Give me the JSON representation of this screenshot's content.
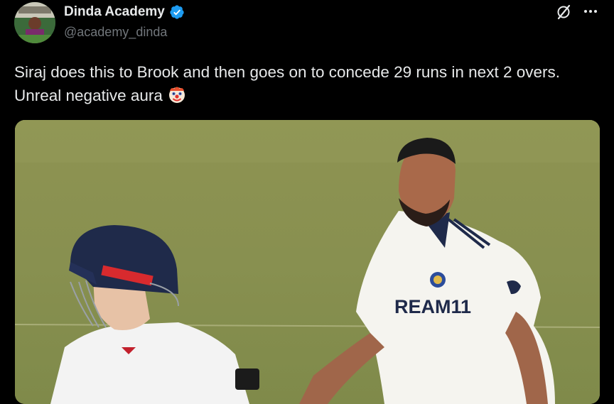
{
  "author": {
    "display_name": "Dinda Academy",
    "handle": "@academy_dinda",
    "verified": true
  },
  "icons": {
    "verified": "verified-badge-icon",
    "grok": "grok-icon",
    "more": "more-options-icon",
    "clown": "clown-face-icon"
  },
  "tweet": {
    "text": "Siraj does this to Brook and then goes on to concede 29 runs in next 2 overs. Unreal negative aura",
    "emoji": "clown-face"
  },
  "media": {
    "kind": "image",
    "jersey_text": "REAM11"
  },
  "colors": {
    "background": "#000000",
    "text": "#e7e9ea",
    "secondary_text": "#71767b",
    "verified_blue": "#1d9bf0"
  }
}
